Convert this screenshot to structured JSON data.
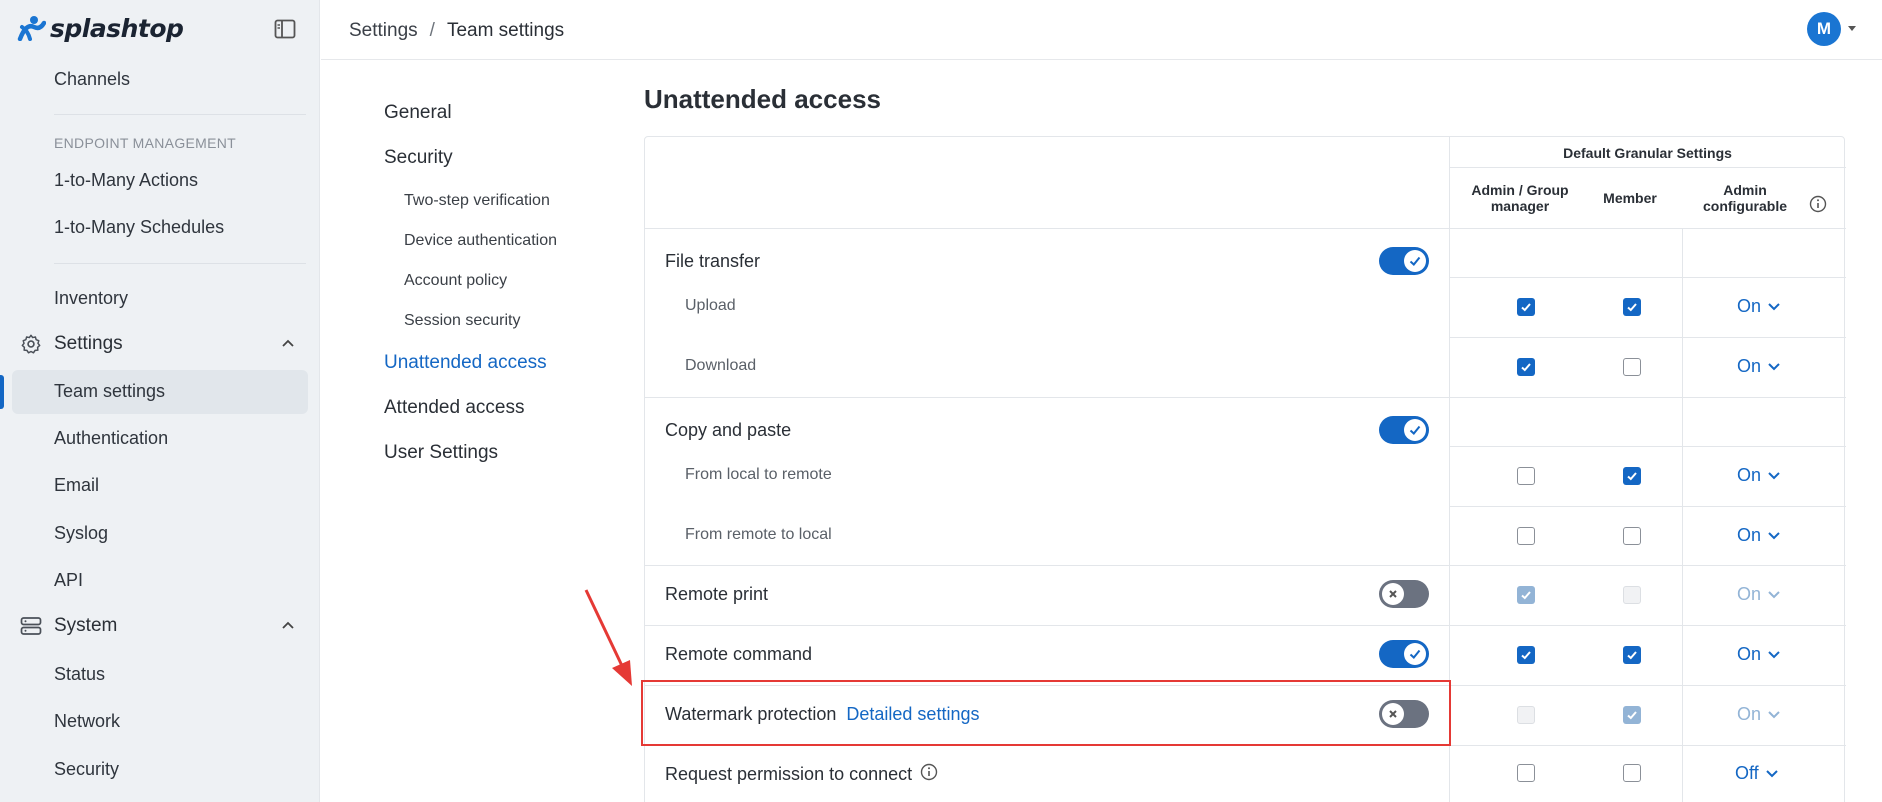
{
  "brand": {
    "name": "splashtop",
    "accent": "#1467c4"
  },
  "sidebar": {
    "channels": "Channels",
    "endpoint_section": "ENDPOINT MANAGEMENT",
    "one_to_many_actions": "1-to-Many Actions",
    "one_to_many_schedules": "1-to-Many Schedules",
    "inventory": "Inventory",
    "settings_group": "Settings",
    "team_settings": "Team settings",
    "authentication": "Authentication",
    "email": "Email",
    "syslog": "Syslog",
    "api": "API",
    "system_group": "System",
    "status": "Status",
    "network": "Network",
    "security": "Security"
  },
  "breadcrumb": {
    "root": "Settings",
    "separator": "/",
    "current": "Team settings"
  },
  "user": {
    "initial": "M"
  },
  "subnav": {
    "general": "General",
    "security": "Security",
    "two_step": "Two-step verification",
    "device_auth": "Device authentication",
    "account_policy": "Account policy",
    "session_security": "Session security",
    "unattended": "Unattended access",
    "attended": "Attended access",
    "user_settings": "User Settings"
  },
  "main": {
    "title": "Unattended access",
    "headers": {
      "group": "Default Granular Settings",
      "admin": "Admin / Group manager",
      "member": "Member",
      "configurable": "Admin configurable"
    },
    "rows": {
      "file_transfer": "File transfer",
      "upload": "Upload",
      "download": "Download",
      "copy_paste": "Copy and paste",
      "local_to_remote": "From local to remote",
      "remote_to_local": "From remote to local",
      "remote_print": "Remote print",
      "remote_command": "Remote command",
      "watermark": "Watermark protection",
      "watermark_link": "Detailed settings",
      "request_permission": "Request permission to connect"
    },
    "values": {
      "upload": "On",
      "download": "On",
      "local_to_remote": "On",
      "remote_to_local": "On",
      "remote_print": "On",
      "remote_command": "On",
      "watermark": "On",
      "request_permission": "Off"
    }
  }
}
